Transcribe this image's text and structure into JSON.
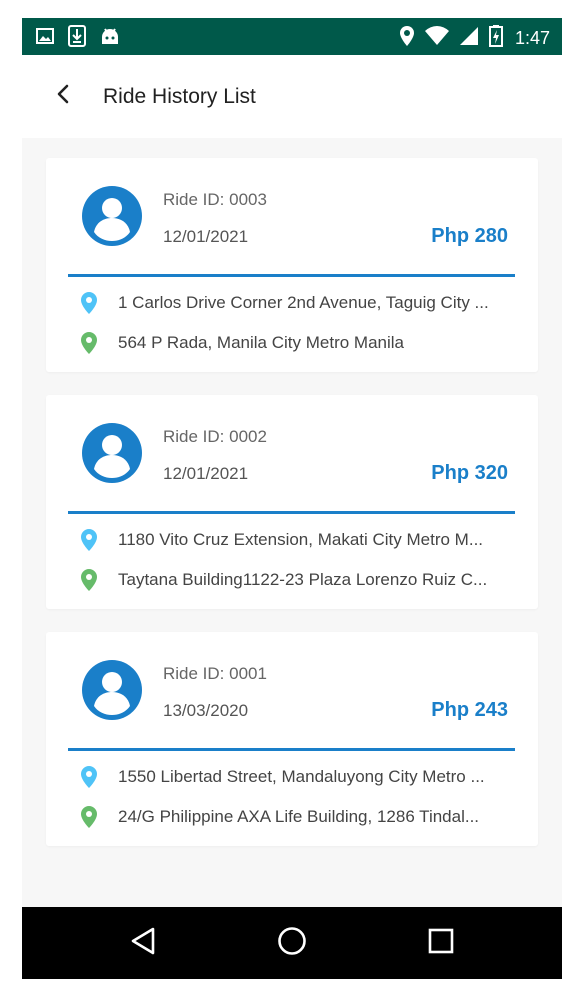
{
  "status_bar": {
    "time": "1:47",
    "left_icons": [
      "image-icon",
      "download-icon",
      "android-icon"
    ],
    "right_icons": [
      "location-icon",
      "wifi-icon",
      "signal-icon",
      "battery-icon"
    ],
    "background": "#00594a"
  },
  "header": {
    "title": "Ride History List",
    "back_icon": "chevron-left-icon"
  },
  "colors": {
    "accent": "#1a7fc9",
    "pickup_pin": "#4fc3f7",
    "dropoff_pin": "#66bb6a"
  },
  "rides": [
    {
      "ride_id": "Ride ID: 0003",
      "date": "12/01/2021",
      "price": "Php 280",
      "pickup": "1 Carlos Drive Corner 2nd Avenue, Taguig City ...",
      "dropoff": "564 P Rada, Manila City Metro Manila"
    },
    {
      "ride_id": "Ride ID: 0002",
      "date": "12/01/2021",
      "price": "Php 320",
      "pickup": "1180 Vito Cruz Extension, Makati City Metro M...",
      "dropoff": "Taytana Building1122-23 Plaza Lorenzo Ruiz C..."
    },
    {
      "ride_id": "Ride ID: 0001",
      "date": "13/03/2020",
      "price": "Php 243",
      "pickup": "1550 Libertad Street, Mandaluyong City Metro ...",
      "dropoff": "24/G Philippine AXA Life Building, 1286 Tindal..."
    }
  ],
  "nav_bar": {
    "icons": [
      "back-triangle-icon",
      "home-circle-icon",
      "recents-square-icon"
    ]
  }
}
